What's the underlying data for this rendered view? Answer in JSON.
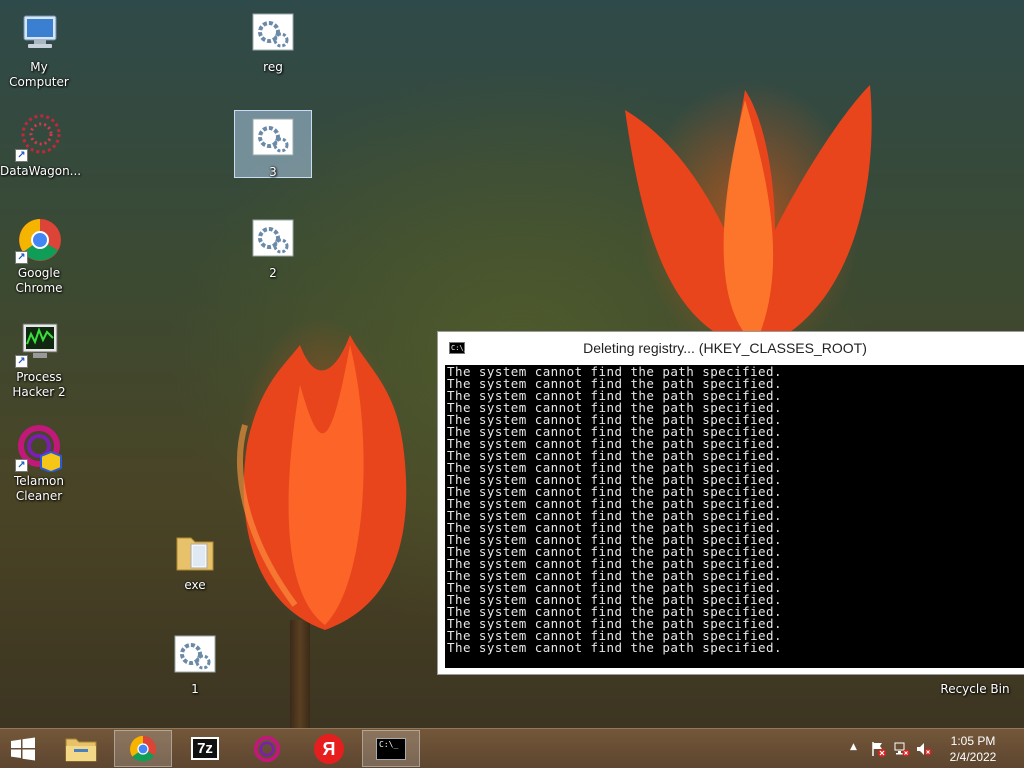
{
  "desktop": {
    "icons": [
      {
        "label": "My Computer"
      },
      {
        "label": "DataWagon..."
      },
      {
        "label": "Google Chrome"
      },
      {
        "label": "Process Hacker 2"
      },
      {
        "label": "Telamon Cleaner"
      },
      {
        "label": "reg"
      },
      {
        "label": "3"
      },
      {
        "label": "2"
      },
      {
        "label": "exe"
      },
      {
        "label": "1"
      },
      {
        "label": "Recycle Bin"
      }
    ]
  },
  "console": {
    "title": "Deleting registry... (HKEY_CLASSES_ROOT)",
    "icon_text": "C:\\_",
    "minimize_glyph": "–",
    "lines": [
      "The system cannot find the path specified.",
      "The system cannot find the path specified.",
      "The system cannot find the path specified.",
      "The system cannot find the path specified.",
      "The system cannot find the path specified.",
      "The system cannot find the path specified.",
      "The system cannot find the path specified.",
      "The system cannot find the path specified.",
      "The system cannot find the path specified.",
      "The system cannot find the path specified.",
      "The system cannot find the path specified.",
      "The system cannot find the path specified.",
      "The system cannot find the path specified.",
      "The system cannot find the path specified.",
      "The system cannot find the path specified.",
      "The system cannot find the path specified.",
      "The system cannot find the path specified.",
      "The system cannot find the path specified.",
      "The system cannot find the path specified.",
      "The system cannot find the path specified.",
      "The system cannot find the path specified.",
      "The system cannot find the path specified.",
      "The system cannot find the path specified.",
      "The system cannot find the path specified."
    ]
  },
  "taskbar": {
    "items": [
      {
        "icon": "file-explorer-icon"
      },
      {
        "icon": "chrome-icon",
        "active": true
      },
      {
        "icon": "7zip-icon",
        "text": "7z"
      },
      {
        "icon": "telamon-icon"
      },
      {
        "icon": "yandex-icon",
        "text": "Я"
      },
      {
        "icon": "cmd-icon",
        "text": "C:\\_"
      }
    ],
    "clock": {
      "time": "1:05 PM",
      "date": "2/4/2022"
    }
  }
}
